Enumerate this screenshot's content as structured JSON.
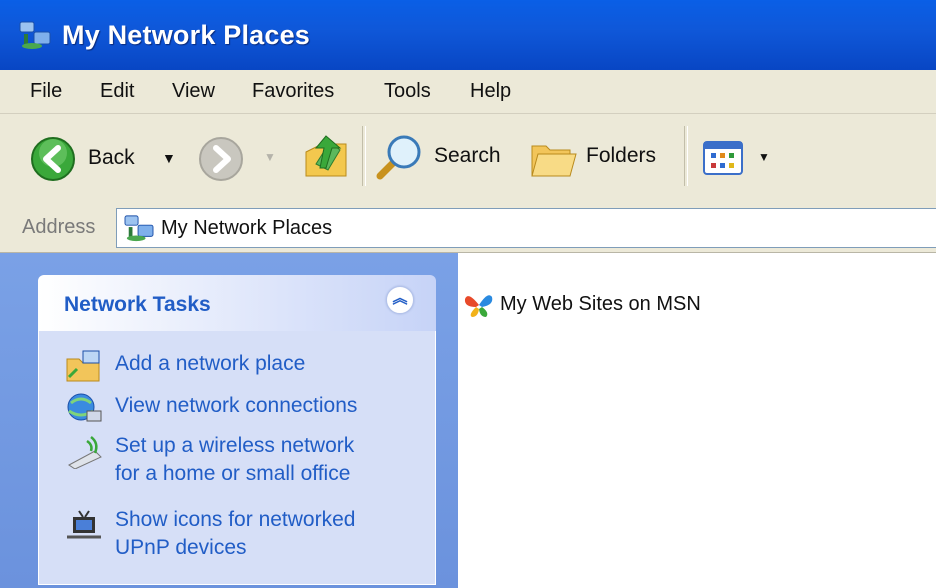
{
  "window": {
    "title": "My Network Places",
    "icon": "network-places-icon"
  },
  "menu": {
    "items": [
      "File",
      "Edit",
      "View",
      "Favorites",
      "Tools",
      "Help"
    ]
  },
  "toolbar": {
    "back_label": "Back",
    "search_label": "Search",
    "folders_label": "Folders",
    "icons": [
      "back-arrow-icon",
      "forward-arrow-icon",
      "up-folder-icon",
      "search-magnifier-icon",
      "folders-icon",
      "views-icon"
    ]
  },
  "address": {
    "label": "Address",
    "value": "My Network Places"
  },
  "tasks_panel": {
    "title": "Network Tasks",
    "tasks": [
      {
        "label_line1": "Add a network place",
        "label_line2": "",
        "icon": "add-network-place-icon"
      },
      {
        "label_line1": "View network connections",
        "label_line2": "",
        "icon": "network-connections-icon"
      },
      {
        "label_line1": "Set up a wireless network",
        "label_line2": "for a home or small office",
        "icon": "wireless-network-icon"
      },
      {
        "label_line1": "Show icons for networked",
        "label_line2": "UPnP devices",
        "icon": "upnp-device-icon"
      }
    ]
  },
  "content": {
    "items": [
      {
        "label": "My Web Sites on MSN",
        "icon": "msn-butterfly-icon"
      }
    ]
  }
}
